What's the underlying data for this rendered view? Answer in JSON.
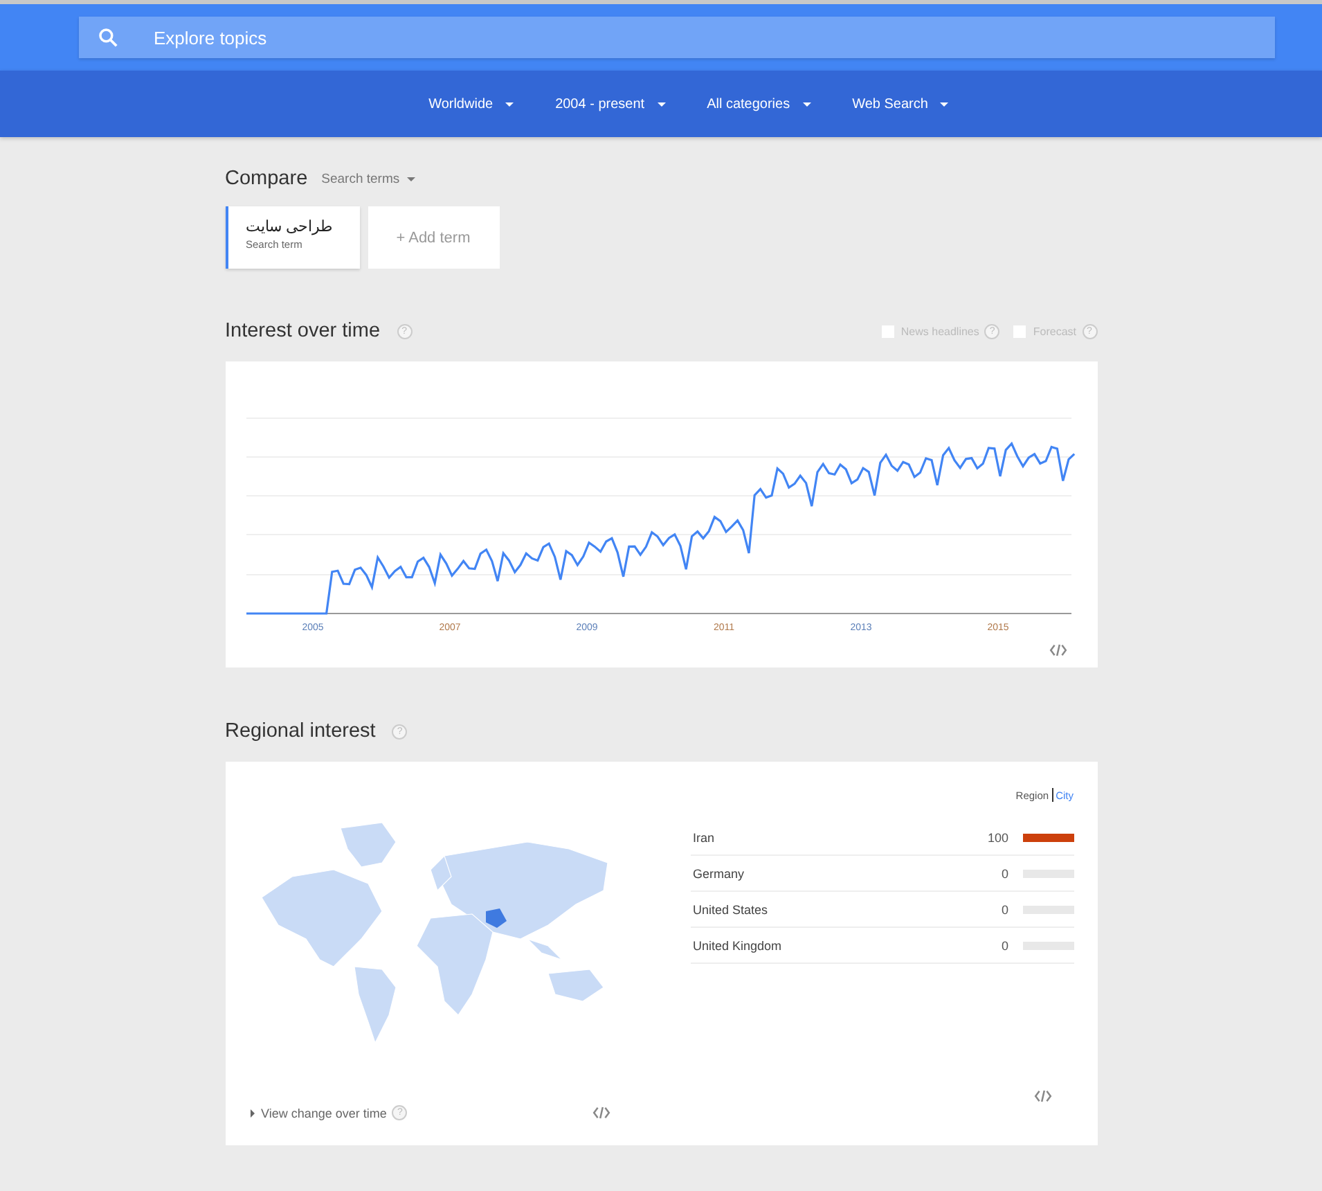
{
  "search": {
    "placeholder": "Explore topics"
  },
  "filters": [
    {
      "label": "Worldwide"
    },
    {
      "label": "2004 - present"
    },
    {
      "label": "All categories"
    },
    {
      "label": "Web Search"
    }
  ],
  "compare": {
    "title": "Compare",
    "mode": "Search terms",
    "terms": [
      {
        "term": "طراحی سایت",
        "sublabel": "Search term"
      }
    ],
    "add_term": "+ Add term"
  },
  "interest_over_time": {
    "title": "Interest over time",
    "help": "?",
    "options": [
      {
        "label": "News headlines",
        "checked": false,
        "help": "?"
      },
      {
        "label": "Forecast",
        "checked": false,
        "help": "?"
      }
    ],
    "x_labels": [
      "2005",
      "2007",
      "2009",
      "2011",
      "2013",
      "2015"
    ]
  },
  "regional_interest": {
    "title": "Regional interest",
    "help": "?",
    "view_toggle": [
      {
        "label": "Region",
        "selected": true
      },
      {
        "label": "City",
        "selected": false
      }
    ],
    "rows": [
      {
        "name": "Iran",
        "value": "100",
        "level": 1
      },
      {
        "name": "Germany",
        "value": "0",
        "level": 0
      },
      {
        "name": "United States",
        "value": "0",
        "level": 0
      },
      {
        "name": "United Kingdom",
        "value": "0",
        "level": 0
      }
    ],
    "view_change": "View change over time",
    "view_change_help": "?"
  }
}
